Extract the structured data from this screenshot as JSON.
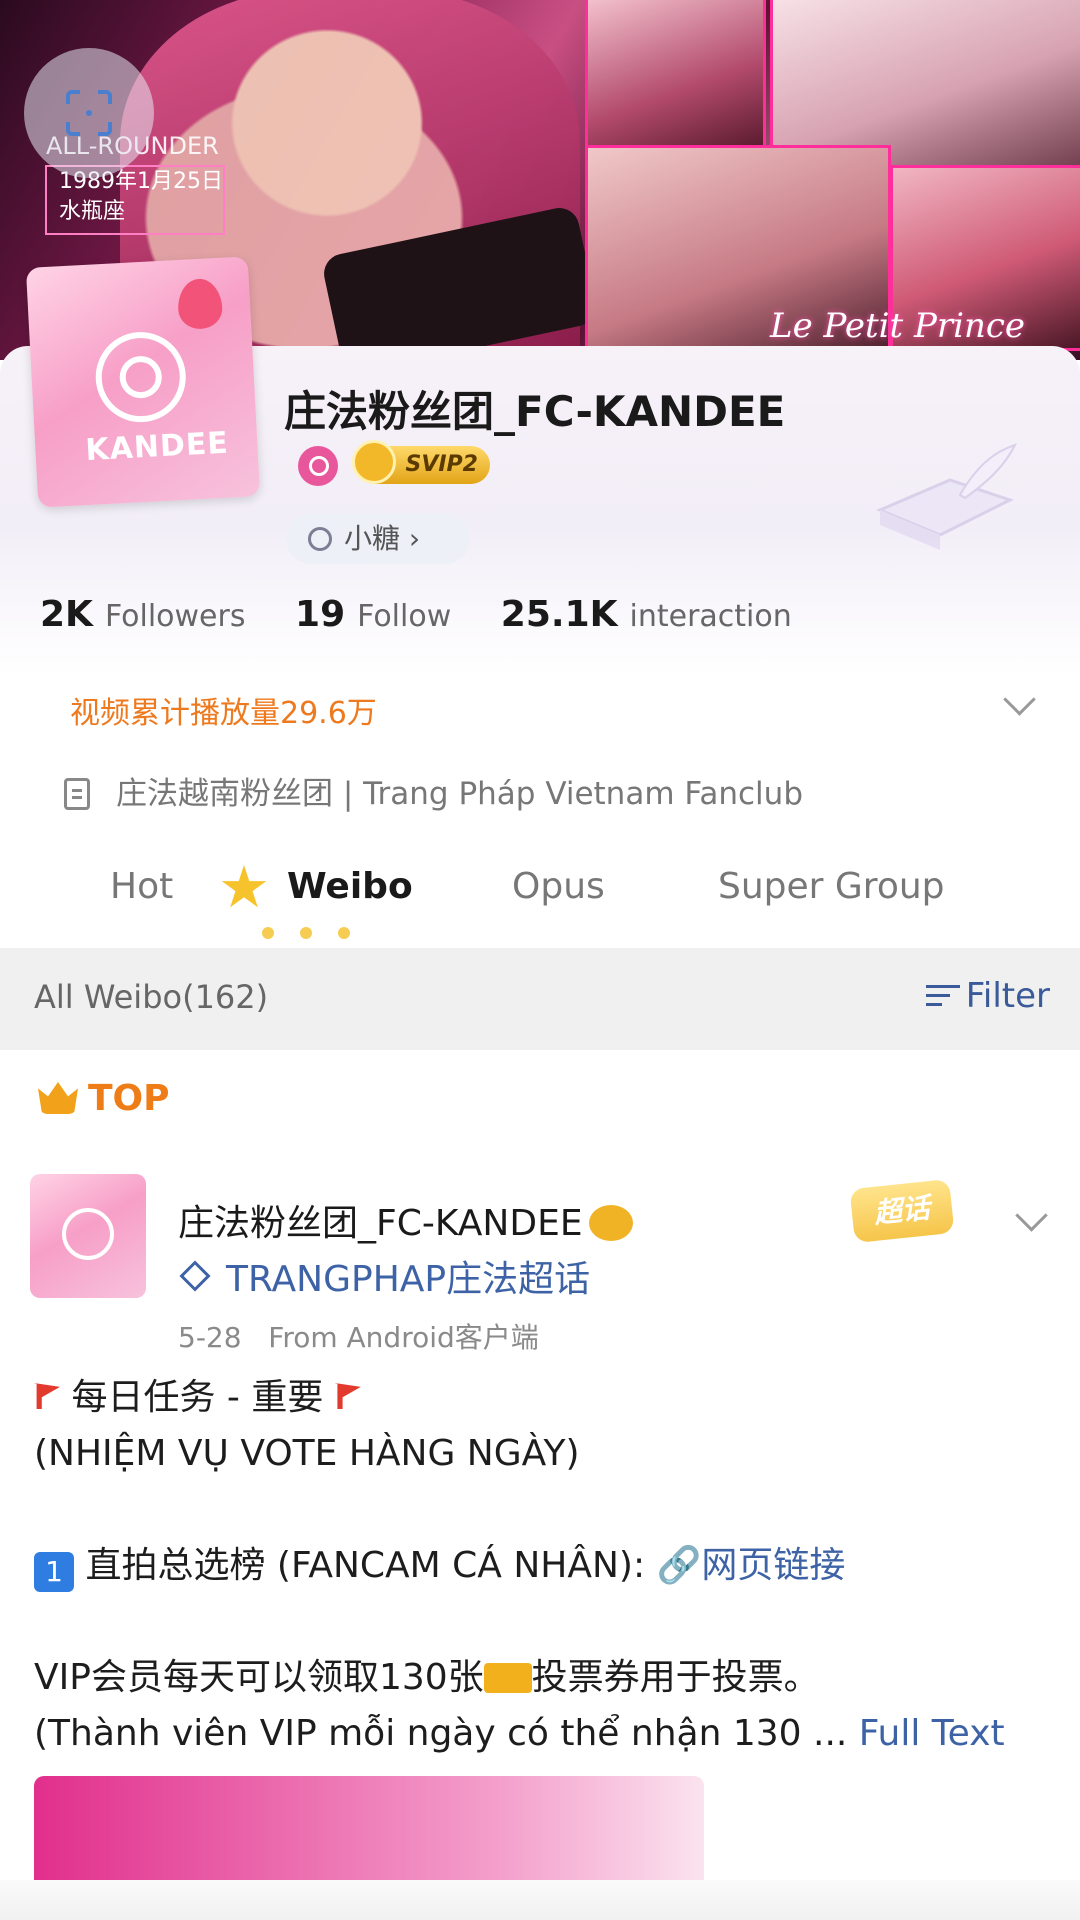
{
  "banner": {
    "tag_text": "ALL-ROUNDER",
    "tag_line1": "1989年1月25日",
    "tag_line2": "水瓶座",
    "signature": "Le Petit Prince"
  },
  "profile": {
    "name": "庄法粉丝团_FC-KANDEE",
    "avatar_brand": "KANDEE",
    "vip_label": "SVIP2",
    "candy_label": "小糖 ›",
    "stats": [
      {
        "value": "2K",
        "label": "Followers"
      },
      {
        "value": "19",
        "label": "Follow"
      },
      {
        "value": "25.1K",
        "label": "interaction"
      }
    ],
    "video_plays": "视频累计播放量29.6万",
    "description": "庄法越南粉丝团 | Trang Pháp Vietnam Fanclub"
  },
  "tabs": [
    {
      "label": "Hot",
      "active": false
    },
    {
      "label": "Weibo",
      "active": true
    },
    {
      "label": "Opus",
      "active": false
    },
    {
      "label": "Super Group",
      "active": false
    }
  ],
  "filterbar": {
    "count_label": "All Weibo(162)",
    "filter_label": "Filter"
  },
  "post": {
    "pin_label": "TOP",
    "author": "庄法粉丝团_FC-KANDEE",
    "topic": "TRANGPHAP庄法超话",
    "badge": "超话",
    "date": "5-28",
    "source": "From Android客户端",
    "line1": "每日任务 - 重要",
    "line2": "(NHIỆM VỤ VOTE HÀNG NGÀY)",
    "line3_num": "1",
    "line3_text": "直拍总选榜 (FANCAM CÁ NHÂN):",
    "line3_link": "网页链接",
    "line4a": "VIP会员每天可以领取130张",
    "line4b": "投票券用于投票。",
    "line5": "(Thành viên VIP mỗi ngày có thể nhận 130 ...",
    "full_text": "Full Text"
  },
  "colors": {
    "accent_orange": "#ee7a1f",
    "link_blue": "#3d63a6",
    "pink": "#e8579c"
  }
}
